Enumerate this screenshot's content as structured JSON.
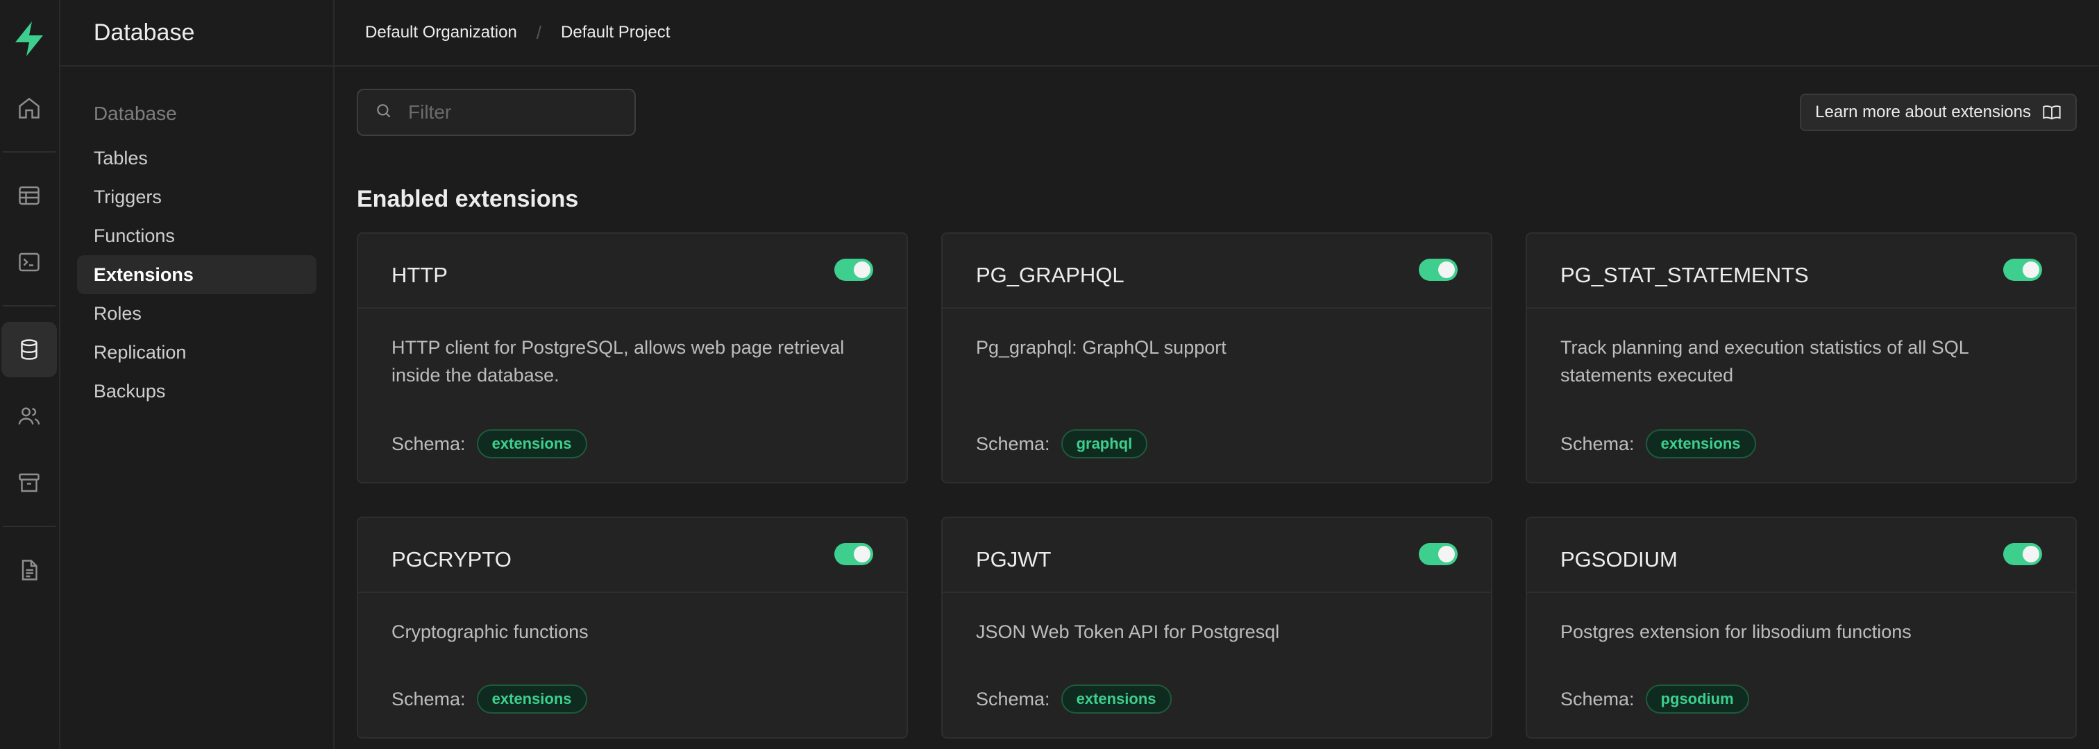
{
  "rail": {
    "icons": [
      "supabase-logo-icon",
      "home-icon",
      "table-editor-icon",
      "sql-editor-icon",
      "database-icon",
      "users-icon",
      "storage-icon",
      "docs-icon"
    ],
    "accent": "#3ecf8e"
  },
  "sidebar": {
    "title": "Database",
    "section_title": "Database",
    "items": [
      {
        "label": "Tables"
      },
      {
        "label": "Triggers"
      },
      {
        "label": "Functions"
      },
      {
        "label": "Extensions",
        "active": true
      },
      {
        "label": "Roles"
      },
      {
        "label": "Replication"
      },
      {
        "label": "Backups"
      }
    ]
  },
  "breadcrumb": {
    "organization": "Default Organization",
    "separator": "/",
    "project": "Default Project"
  },
  "toolbar": {
    "filter_placeholder": "Filter",
    "filter_value": "",
    "learn_more_label": "Learn more about extensions"
  },
  "enabled": {
    "title": "Enabled extensions",
    "schema_label": "Schema:",
    "extensions": [
      {
        "name": "HTTP",
        "description": "HTTP client for PostgreSQL, allows web page retrieval inside the database.",
        "schema": "extensions",
        "enabled": true
      },
      {
        "name": "PG_GRAPHQL",
        "description": "Pg_graphql: GraphQL support",
        "schema": "graphql",
        "enabled": true
      },
      {
        "name": "PG_STAT_STATEMENTS",
        "description": "Track planning and execution statistics of all SQL statements executed",
        "schema": "extensions",
        "enabled": true
      },
      {
        "name": "PGCRYPTO",
        "description": "Cryptographic functions",
        "schema": "extensions",
        "enabled": true
      },
      {
        "name": "PGJWT",
        "description": "JSON Web Token API for Postgresql",
        "schema": "extensions",
        "enabled": true
      },
      {
        "name": "PGSODIUM",
        "description": "Postgres extension for libsodium functions",
        "schema": "pgsodium",
        "enabled": true
      }
    ]
  }
}
